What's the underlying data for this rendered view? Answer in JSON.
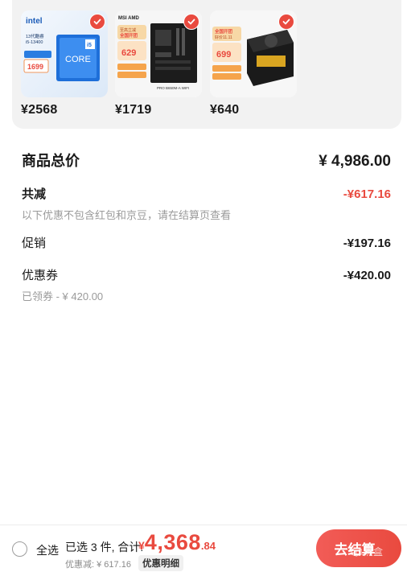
{
  "products": [
    {
      "name": "intel-cpu",
      "price": "¥2568",
      "brand": "intel",
      "tag": "i5",
      "model": "13代酷睿 i5-13400",
      "badge_price": "1699"
    },
    {
      "name": "msi-motherboard",
      "price": "¥1719",
      "brand": "MSI AMD",
      "badge_text": "至高立减 全国开团 好价11.11",
      "badge_price": "629"
    },
    {
      "name": "power-supply",
      "price": "¥640",
      "badge_text": "全国开团 好价11.11",
      "badge_price": "699"
    }
  ],
  "summary": {
    "total_label": "商品总价",
    "total_value": "¥ 4,986.00",
    "reduce_label": "共减",
    "reduce_value": "-¥617.16",
    "reduce_note": "以下优惠不包含红包和京豆，请在结算页查看",
    "promo_label": "促销",
    "promo_value": "-¥197.16",
    "coupon_label": "优惠券",
    "coupon_value": "-¥420.00",
    "coupon_note": "已领券 - ¥ 420.00"
  },
  "bottom": {
    "select_all": "全选",
    "selected_text": "已选 3 件, 合计:",
    "currency": "¥",
    "total_int": "4,368",
    "total_dec": ".84",
    "discount_text": "优惠减: ¥ 617.16",
    "detail_label": "优惠明细",
    "checkout_label": "去结算",
    "watermark": "黑盒"
  },
  "colors": {
    "accent": "#e94a3f",
    "muted": "#9a9a9a"
  }
}
